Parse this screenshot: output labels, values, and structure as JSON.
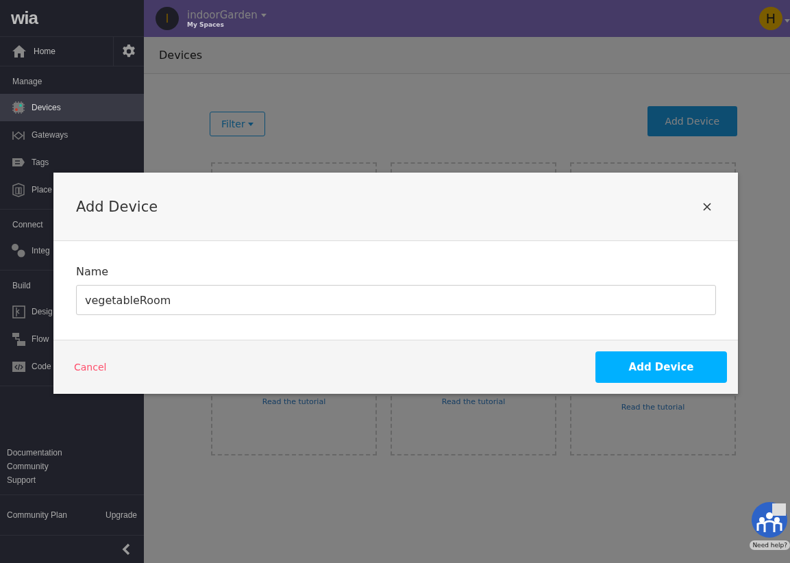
{
  "sidebar": {
    "logo": "wia",
    "home": "Home",
    "sections": [
      {
        "title": "Manage",
        "items": [
          {
            "label": "Devices",
            "selected": true
          },
          {
            "label": "Gateways",
            "selected": false
          },
          {
            "label": "Tags",
            "selected": false
          },
          {
            "label": "Place",
            "selected": false
          }
        ]
      },
      {
        "title": "Connect",
        "items": [
          {
            "label": "Integ",
            "selected": false
          }
        ]
      },
      {
        "title": "Build",
        "items": [
          {
            "label": "Desig",
            "selected": false
          },
          {
            "label": "Flow",
            "selected": false
          },
          {
            "label": "Code",
            "selected": false
          }
        ]
      }
    ],
    "links": [
      "Documentation",
      "Community",
      "Support"
    ],
    "plan": "Community Plan",
    "upgrade": "Upgrade"
  },
  "header": {
    "space_initial": "I",
    "space_name": "indoorGarden",
    "space_sub": "My Spaces",
    "user_initial": "H"
  },
  "page_title": "Devices",
  "toolbar": {
    "filter": "Filter",
    "add": "Add Device"
  },
  "cards": [
    {
      "link": "Read the tutorial"
    },
    {
      "link": "Read the tutorial"
    },
    {
      "link": "Read the tutorial"
    }
  ],
  "help": "Need help?",
  "modal": {
    "title": "Add Device",
    "field_label": "Name",
    "field_value": "vegetableRoom",
    "cancel": "Cancel",
    "submit": "Add Device"
  }
}
